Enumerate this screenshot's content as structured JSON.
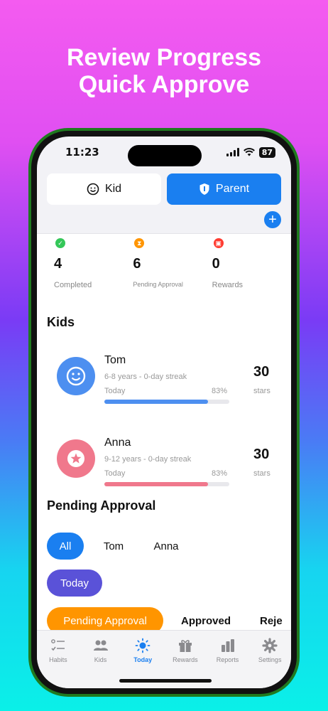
{
  "headline": {
    "line1": "Review Progress",
    "line2": "Quick Approve"
  },
  "status_bar": {
    "time": "11:23",
    "battery": "87"
  },
  "mode_toggle": {
    "kid_label": "Kid",
    "parent_label": "Parent",
    "active": "Parent"
  },
  "add_button": {
    "label": "+"
  },
  "stats": [
    {
      "value": "4",
      "label": "Completed",
      "color": "#34c759",
      "icon": "checkmark-icon"
    },
    {
      "value": "6",
      "label": "Pending Approval",
      "color": "#ff9500",
      "icon": "hourglass-icon"
    },
    {
      "value": "0",
      "label": "Rewards",
      "color": "#ff3b30",
      "icon": "gift-icon"
    }
  ],
  "kids_section": {
    "title": "Kids"
  },
  "kids": [
    {
      "name": "Tom",
      "meta": "6-8 years - 0-day streak",
      "today_label": "Today",
      "percent": "83%",
      "progress": 0.83,
      "stars": "30",
      "stars_label": "stars",
      "color": "#4d8ff0",
      "icon": "smiley-icon"
    },
    {
      "name": "Anna",
      "meta": "9-12 years - 0-day streak",
      "today_label": "Today",
      "percent": "83%",
      "progress": 0.83,
      "stars": "30",
      "stars_label": "stars",
      "color": "#f0788c",
      "icon": "star-icon"
    }
  ],
  "pending_section": {
    "title": "Pending Approval"
  },
  "kid_filters": {
    "all": "All",
    "tom": "Tom",
    "anna": "Anna",
    "selected": "All"
  },
  "date_filter": {
    "today": "Today"
  },
  "status_tabs": {
    "pending": "Pending Approval",
    "approved": "Approved",
    "rejected": "Reje",
    "selected": "Pending Approval"
  },
  "tabbar": [
    {
      "label": "Habits",
      "icon": "checklist-icon"
    },
    {
      "label": "Kids",
      "icon": "people-icon"
    },
    {
      "label": "Today",
      "icon": "sun-icon",
      "active": true
    },
    {
      "label": "Rewards",
      "icon": "gift-icon"
    },
    {
      "label": "Reports",
      "icon": "bar-chart-icon"
    },
    {
      "label": "Settings",
      "icon": "gear-icon"
    }
  ]
}
